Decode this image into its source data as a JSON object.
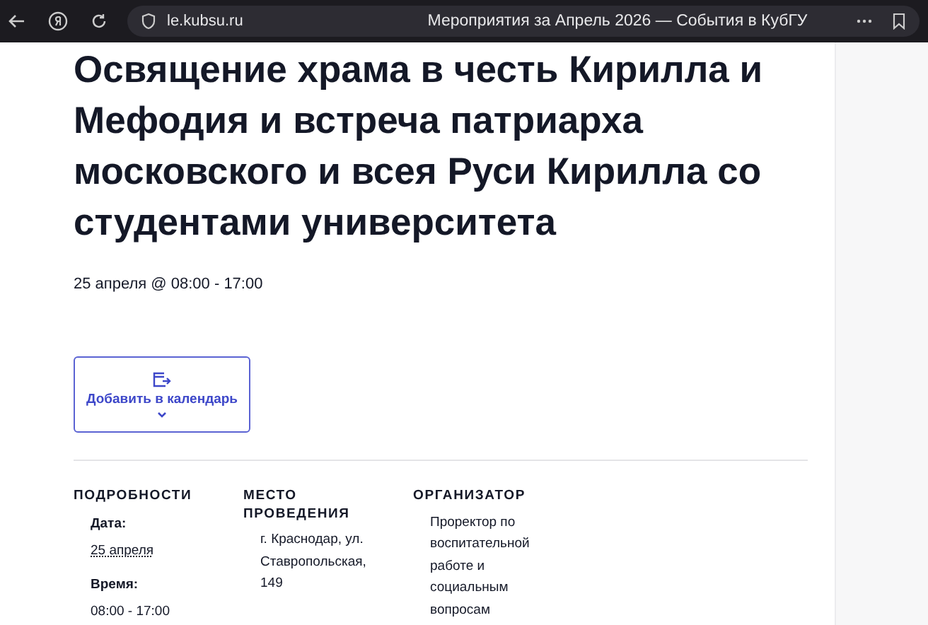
{
  "browser": {
    "url": "le.kubsu.ru",
    "title": "Мероприятия за Апрель 2026 — События в КубГУ"
  },
  "event": {
    "title": "Освящение храма в честь Кирилла и Мефодия и встреча патриарха московского и всея Руси Кирилла со студентами университета",
    "schedule": "25 апреля @ 08:00 - 17:00",
    "calendar_button": "Добавить в календарь"
  },
  "details": [
    {
      "heading": "ПОДРОБНОСТИ",
      "items": [
        {
          "label": "Дата:",
          "value": "25 апреля",
          "kind": "abbr"
        },
        {
          "label": "Время:",
          "value": "08:00 - 17:00",
          "kind": "plain"
        }
      ]
    },
    {
      "heading": "МЕСТО ПРОВЕДЕНИЯ",
      "text": "г. Краснодар, ул. Ставропольская, 149"
    },
    {
      "heading": "ОРГАНИЗАТОР",
      "text": "Проректор по воспитательной работе и социальным вопросам"
    }
  ]
}
